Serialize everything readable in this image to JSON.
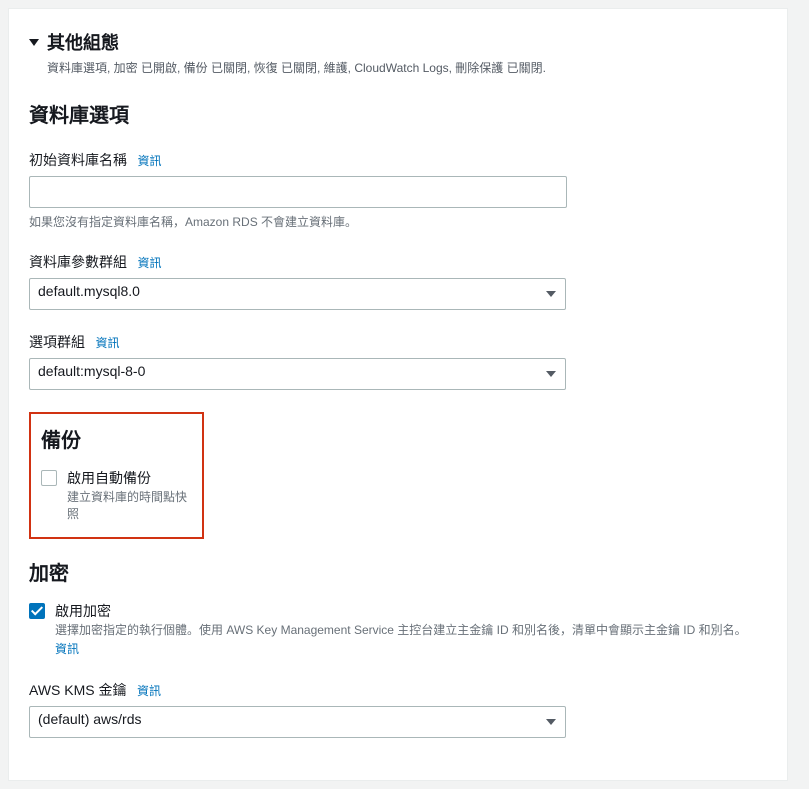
{
  "header": {
    "title": "其他組態",
    "subtitle": "資料庫選項, 加密 已開啟, 備份 已關閉, 恢復 已關閉, 維護, CloudWatch Logs, 刪除保護 已關閉."
  },
  "dbOptions": {
    "heading": "資料庫選項",
    "initialDbName": {
      "label": "初始資料庫名稱",
      "infoLabel": "資訊",
      "value": "",
      "helper": "如果您沒有指定資料庫名稱，Amazon RDS 不會建立資料庫。"
    },
    "paramGroup": {
      "label": "資料庫參數群組",
      "infoLabel": "資訊",
      "selected": "default.mysql8.0"
    },
    "optionGroup": {
      "label": "選項群組",
      "infoLabel": "資訊",
      "selected": "default:mysql-8-0"
    }
  },
  "backup": {
    "heading": "備份",
    "enable": {
      "label": "啟用自動備份",
      "desc": "建立資料庫的時間點快照",
      "checked": false
    }
  },
  "encryption": {
    "heading": "加密",
    "enable": {
      "label": "啟用加密",
      "desc": "選擇加密指定的執行個體。使用 AWS Key Management Service 主控台建立主金鑰 ID 和別名後，清單中會顯示主金鑰 ID 和別名。",
      "infoLabel": "資訊",
      "checked": true
    },
    "kmsKey": {
      "label": "AWS KMS 金鑰",
      "infoLabel": "資訊",
      "selected": "(default) aws/rds"
    }
  }
}
